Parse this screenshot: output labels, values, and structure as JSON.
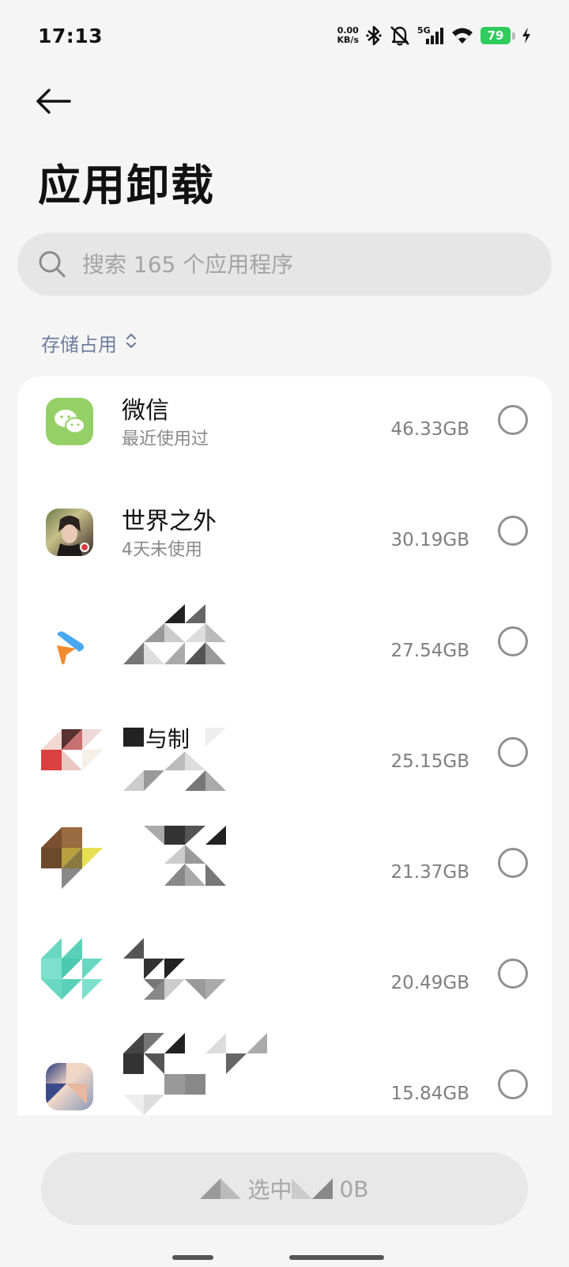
{
  "status_bar": {
    "time": "17:13",
    "net_speed_value": "0.00",
    "net_speed_unit": "KB/s",
    "network_type": "5G",
    "battery_level": "79",
    "battery_color": "#2fcb5c"
  },
  "header": {
    "back_icon": "arrow-left-icon",
    "title": "应用卸载"
  },
  "search": {
    "placeholder": "搜索 165 个应用程序",
    "value": ""
  },
  "sort": {
    "label": "存储占用",
    "icon": "sort-updown-icon"
  },
  "apps": [
    {
      "name": "微信",
      "subtitle": "最近使用过",
      "size": "46.33GB",
      "icon": "wechat-icon",
      "selected": false
    },
    {
      "name": "世界之外",
      "subtitle": "4天未使用",
      "size": "30.19GB",
      "icon": "game-portrait-icon",
      "selected": false
    },
    {
      "name": "",
      "subtitle": "",
      "size": "27.54GB",
      "icon": "blue-orange-arrow-icon",
      "selected": false
    },
    {
      "name": "与制",
      "subtitle": "",
      "size": "25.15GB",
      "icon": "redacted-icon",
      "selected": false
    },
    {
      "name": "",
      "subtitle": "",
      "size": "21.37GB",
      "icon": "redacted-icon",
      "selected": false
    },
    {
      "name": "",
      "subtitle": "",
      "size": "20.49GB",
      "icon": "redacted-icon",
      "selected": false
    },
    {
      "name": "",
      "subtitle": "",
      "size": "15.84GB",
      "icon": "redacted-icon",
      "selected": false
    }
  ],
  "bottom": {
    "uninstall_label": "选中",
    "uninstall_suffix": "0B"
  },
  "colors": {
    "accent_text": "#6f7fa0",
    "wechat_green": "#95d066"
  }
}
